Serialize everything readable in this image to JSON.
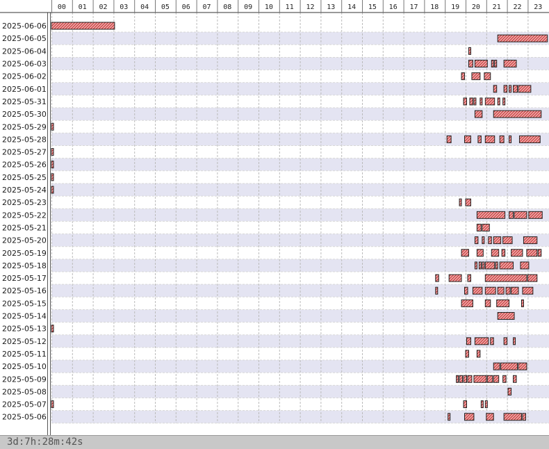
{
  "chart_data": {
    "type": "timeline",
    "hours": [
      "00",
      "01",
      "02",
      "03",
      "04",
      "05",
      "06",
      "07",
      "08",
      "09",
      "10",
      "11",
      "12",
      "13",
      "14",
      "15",
      "16",
      "17",
      "18",
      "19",
      "20",
      "21",
      "22",
      "23"
    ],
    "dates": [
      "2025-06-06",
      "2025-06-05",
      "2025-06-04",
      "2025-06-03",
      "2025-06-02",
      "2025-06-01",
      "2025-05-31",
      "2025-05-30",
      "2025-05-29",
      "2025-05-28",
      "2025-05-27",
      "2025-05-26",
      "2025-05-25",
      "2025-05-24",
      "2025-05-23",
      "2025-05-22",
      "2025-05-21",
      "2025-05-20",
      "2025-05-19",
      "2025-05-18",
      "2025-05-17",
      "2025-05-16",
      "2025-05-15",
      "2025-05-14",
      "2025-05-13",
      "2025-05-12",
      "2025-05-11",
      "2025-05-10",
      "2025-05-09",
      "2025-05-08",
      "2025-05-07",
      "2025-05-06"
    ],
    "sessions": [
      [
        [
          0.0,
          3.05
        ]
      ],
      [
        [
          21.55,
          23.95
        ]
      ],
      [
        [
          20.15,
          20.25
        ]
      ],
      [
        [
          20.15,
          20.35
        ],
        [
          20.45,
          21.05
        ],
        [
          21.25,
          21.35
        ],
        [
          21.4,
          21.5
        ],
        [
          21.85,
          22.45
        ]
      ],
      [
        [
          19.8,
          19.95
        ],
        [
          20.3,
          20.7
        ],
        [
          20.9,
          21.2
        ]
      ],
      [
        [
          21.35,
          21.5
        ],
        [
          21.85,
          22.0
        ],
        [
          22.1,
          22.2
        ],
        [
          22.3,
          22.5
        ],
        [
          22.55,
          23.15
        ]
      ],
      [
        [
          19.9,
          20.05
        ],
        [
          20.2,
          20.35
        ],
        [
          20.4,
          20.5
        ],
        [
          20.7,
          20.8
        ],
        [
          20.95,
          21.4
        ],
        [
          21.55,
          21.65
        ],
        [
          21.8,
          21.9
        ]
      ],
      [
        [
          20.45,
          20.8
        ],
        [
          21.35,
          23.65
        ]
      ],
      [
        [
          0.0,
          0.05
        ]
      ],
      [
        [
          19.1,
          19.3
        ],
        [
          19.95,
          20.25
        ],
        [
          20.6,
          20.75
        ],
        [
          20.95,
          21.4
        ],
        [
          21.65,
          21.85
        ],
        [
          22.1,
          22.2
        ],
        [
          22.6,
          23.6
        ]
      ],
      [
        [
          0.0,
          0.05
        ]
      ],
      [
        [
          0.0,
          0.05
        ]
      ],
      [
        [
          0.0,
          0.05
        ]
      ],
      [
        [
          0.0,
          0.05
        ]
      ],
      [
        [
          19.7,
          19.8
        ],
        [
          20.0,
          20.25
        ]
      ],
      [
        [
          20.55,
          21.9
        ],
        [
          22.1,
          22.3
        ],
        [
          22.35,
          22.95
        ],
        [
          23.05,
          23.7
        ]
      ],
      [
        [
          20.55,
          20.75
        ],
        [
          20.8,
          21.15
        ]
      ],
      [
        [
          20.45,
          20.6
        ],
        [
          20.8,
          20.9
        ],
        [
          21.1,
          21.25
        ],
        [
          21.35,
          21.7
        ],
        [
          21.8,
          22.25
        ],
        [
          22.8,
          23.45
        ]
      ],
      [
        [
          19.8,
          20.15
        ],
        [
          20.55,
          20.85
        ],
        [
          21.25,
          21.6
        ],
        [
          21.75,
          21.9
        ],
        [
          22.2,
          22.75
        ],
        [
          22.95,
          23.45
        ],
        [
          23.5,
          23.65
        ]
      ],
      [
        [
          20.45,
          20.55
        ],
        [
          20.65,
          20.75
        ],
        [
          20.8,
          20.9
        ],
        [
          20.95,
          21.4
        ],
        [
          21.45,
          21.55
        ],
        [
          21.65,
          22.3
        ],
        [
          22.65,
          23.05
        ]
      ],
      [
        [
          18.55,
          18.7
        ],
        [
          19.2,
          19.8
        ],
        [
          20.1,
          20.25
        ],
        [
          20.95,
          22.95
        ],
        [
          23.0,
          23.45
        ]
      ],
      [
        [
          18.55,
          18.6
        ],
        [
          19.95,
          20.1
        ],
        [
          20.35,
          20.8
        ],
        [
          20.95,
          21.45
        ],
        [
          21.55,
          21.85
        ],
        [
          21.95,
          22.15
        ],
        [
          22.2,
          22.55
        ],
        [
          22.75,
          23.25
        ]
      ],
      [
        [
          19.8,
          20.35
        ],
        [
          20.95,
          21.2
        ],
        [
          21.5,
          22.1
        ],
        [
          22.7,
          22.8
        ]
      ],
      [
        [
          21.55,
          22.35
        ]
      ],
      [
        [
          0.0,
          0.05
        ]
      ],
      [
        [
          20.05,
          20.25
        ],
        [
          20.45,
          21.1
        ],
        [
          21.2,
          21.35
        ],
        [
          21.85,
          22.0
        ],
        [
          22.3,
          22.4
        ]
      ],
      [
        [
          20.0,
          20.15
        ],
        [
          20.55,
          20.7
        ]
      ],
      [
        [
          21.35,
          21.65
        ],
        [
          21.7,
          22.5
        ],
        [
          22.55,
          22.95
        ]
      ],
      [
        [
          19.55,
          19.65
        ],
        [
          19.7,
          19.85
        ],
        [
          19.9,
          20.05
        ],
        [
          20.1,
          20.3
        ],
        [
          20.4,
          21.0
        ],
        [
          21.05,
          21.3
        ],
        [
          21.35,
          21.6
        ],
        [
          21.8,
          21.95
        ],
        [
          22.3,
          22.45
        ]
      ],
      [
        [
          22.05,
          22.2
        ]
      ],
      [
        [
          0.0,
          0.05
        ],
        [
          19.9,
          20.05
        ],
        [
          20.75,
          20.85
        ],
        [
          20.95,
          21.05
        ]
      ],
      [
        [
          19.15,
          19.25
        ],
        [
          19.95,
          20.4
        ],
        [
          21.0,
          21.35
        ],
        [
          21.85,
          22.7
        ],
        [
          22.75,
          22.9
        ]
      ]
    ]
  },
  "footer": {
    "total": "3d:7h:28m:42s"
  }
}
